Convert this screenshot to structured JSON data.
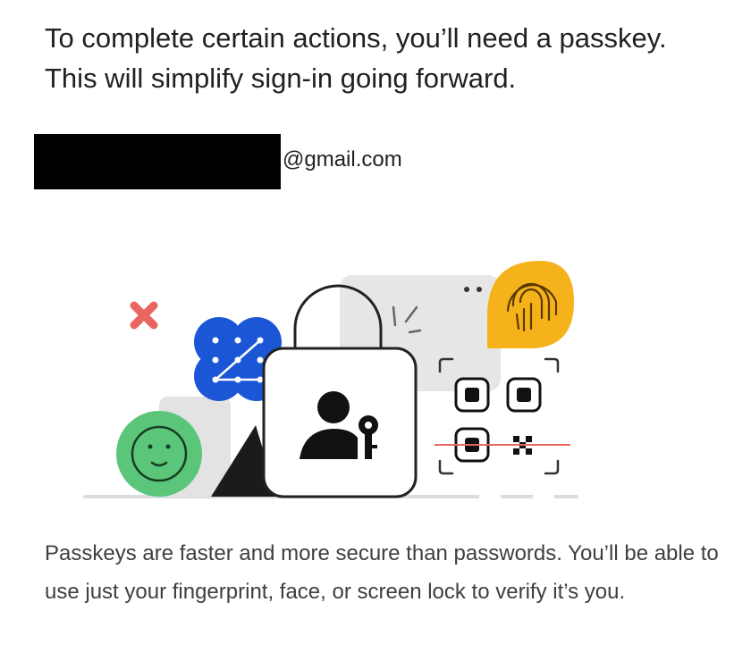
{
  "intro_text": "To complete certain actions, you’ll need a passkey. This will simplify sign-in going forward.",
  "account": {
    "email_domain": "@gmail.com"
  },
  "footer_text": "Passkeys are faster and more secure than passwords. You’ll be able to use just your fingerprint, face, or screen lock to verify it’s you.",
  "illustration": {
    "icons": [
      "x-mark-icon",
      "pattern-lock-icon",
      "face-icon",
      "padlock-icon",
      "person-key-icon",
      "fingerprint-icon",
      "qr-code-icon"
    ]
  },
  "colors": {
    "text": "#202124",
    "secondary_text": "#3c4043",
    "green": "#5bc67a",
    "blue": "#1a56d6",
    "yellow": "#f6b21b",
    "red": "#e8665f",
    "gray": "#dadce0"
  }
}
